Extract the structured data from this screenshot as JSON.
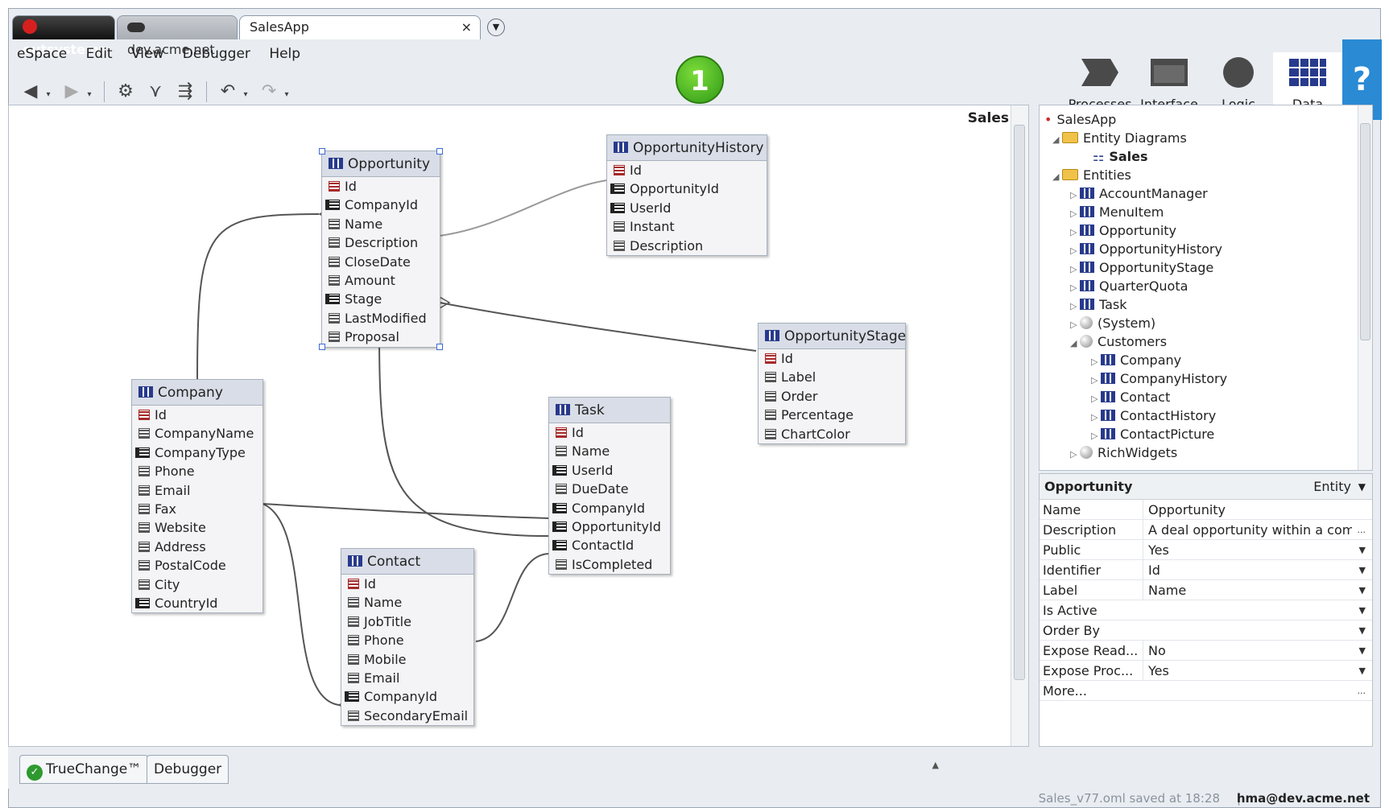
{
  "tabs": [
    {
      "label": "outsystems"
    },
    {
      "label": "dev.acme.net"
    },
    {
      "label": "SalesApp",
      "close": "×"
    }
  ],
  "menu": [
    "eSpace",
    "Edit",
    "View",
    "Debugger",
    "Help"
  ],
  "badge": "1",
  "layers": [
    {
      "label": "Processes",
      "icon": "processes-icon"
    },
    {
      "label": "Interface",
      "icon": "interface-icon"
    },
    {
      "label": "Logic",
      "icon": "logic-icon"
    },
    {
      "label": "Data",
      "icon": "data-icon"
    }
  ],
  "help": "?",
  "diagram": {
    "name": "Sales",
    "entities": {
      "opportunity": {
        "name": "Opportunity",
        "attrs": [
          "Id",
          "CompanyId",
          "Name",
          "Description",
          "CloseDate",
          "Amount",
          "Stage",
          "LastModified",
          "Proposal"
        ]
      },
      "opportunity_history": {
        "name": "OpportunityHistory",
        "attrs": [
          "Id",
          "OpportunityId",
          "UserId",
          "Instant",
          "Description"
        ]
      },
      "opportunity_stage": {
        "name": "OpportunityStage",
        "attrs": [
          "Id",
          "Label",
          "Order",
          "Percentage",
          "ChartColor"
        ]
      },
      "company": {
        "name": "Company",
        "attrs": [
          "Id",
          "CompanyName",
          "CompanyType",
          "Phone",
          "Email",
          "Fax",
          "Website",
          "Address",
          "PostalCode",
          "City",
          "CountryId"
        ]
      },
      "task": {
        "name": "Task",
        "attrs": [
          "Id",
          "Name",
          "UserId",
          "DueDate",
          "CompanyId",
          "OpportunityId",
          "ContactId",
          "IsCompleted"
        ]
      },
      "contact": {
        "name": "Contact",
        "attrs": [
          "Id",
          "Name",
          "JobTitle",
          "Phone",
          "Mobile",
          "Email",
          "CompanyId",
          "SecondaryEmail"
        ]
      }
    }
  },
  "tree": {
    "root": "SalesApp",
    "entity_diagrams": "Entity Diagrams",
    "diagram": "Sales",
    "entities": "Entities",
    "entity_list": [
      "AccountManager",
      "MenuItem",
      "Opportunity",
      "OpportunityHistory",
      "OpportunityStage",
      "QuarterQuota",
      "Task"
    ],
    "system": "(System)",
    "customers": "Customers",
    "customer_entities": [
      "Company",
      "CompanyHistory",
      "Contact",
      "ContactHistory",
      "ContactPicture"
    ],
    "rich_widgets": "RichWidgets"
  },
  "properties": {
    "title": "Opportunity",
    "kind": "Entity",
    "rows": [
      {
        "key": "Name",
        "value": "Opportunity"
      },
      {
        "key": "Description",
        "value": "A deal opportunity within a comp"
      },
      {
        "key": "Public",
        "value": "Yes"
      },
      {
        "key": "Identifier",
        "value": "Id"
      },
      {
        "key": "Label",
        "value": "Name"
      },
      {
        "key": "Is Active",
        "value": ""
      },
      {
        "key": "Order By",
        "value": ""
      },
      {
        "key": "Expose Read...",
        "value": "No"
      },
      {
        "key": "Expose Proc...",
        "value": "Yes"
      },
      {
        "key": "More...",
        "value": ""
      }
    ]
  },
  "bottom_tabs": [
    "TrueChange™",
    "Debugger"
  ],
  "status": {
    "text": "Sales_v77.oml saved at 18:28",
    "separator": "|",
    "user": "hma@dev.acme.net"
  }
}
